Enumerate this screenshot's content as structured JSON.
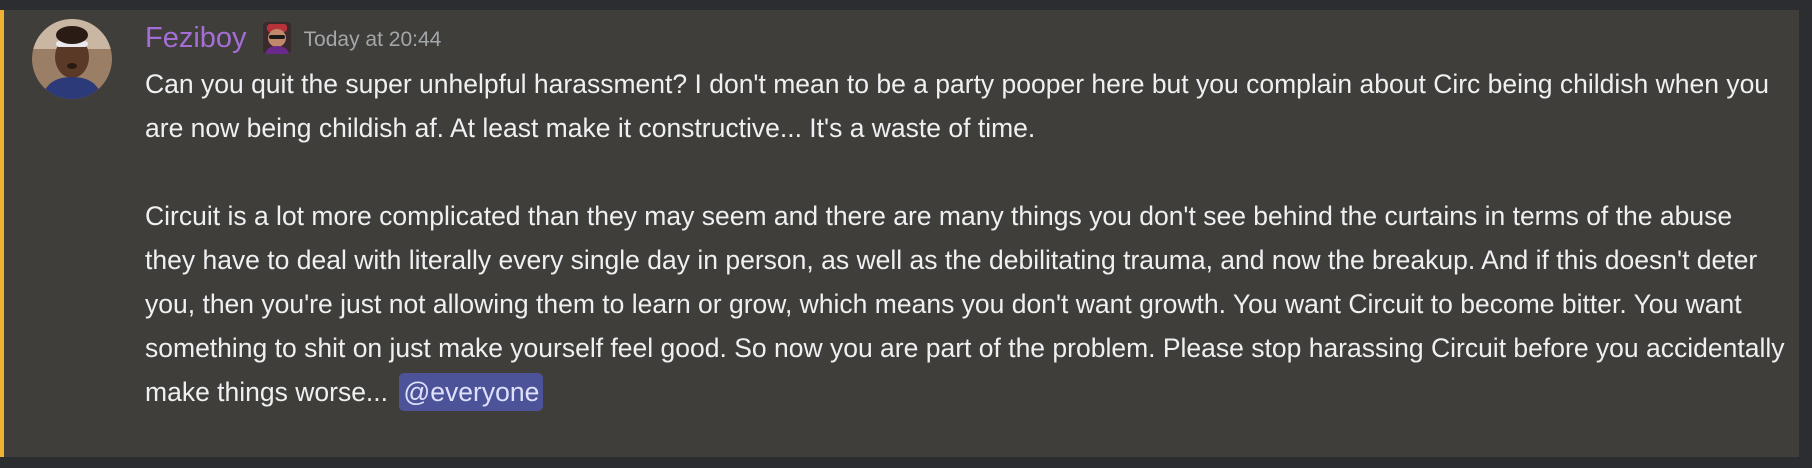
{
  "message": {
    "author": {
      "username": "Feziboy",
      "username_color": "#a46ed6",
      "avatar_icon": "user-avatar",
      "role_icon": "role-emoji-icon"
    },
    "timestamp": "Today at 20:44",
    "highlight_color": "#f0b232",
    "paragraphs": [
      "Can you quit the super unhelpful harassment? I don't mean to be a party pooper here but you complain about Circ being childish when you are now being childish af. At least make it constructive... It's a waste of time.",
      "Circuit is a lot more complicated than they may seem and there are many things you don't see behind the curtains in terms of the abuse they have to deal with literally every single day in person, as well as the debilitating trauma, and now the breakup. And if this doesn't deter you, then you're just not allowing them to learn or grow, which means you don't want growth. You want Circuit to become bitter. You want something to shit on just make yourself feel good. So now you are part of the problem. Please stop harassing Circuit before you accidentally make things worse..."
    ],
    "mention": "@everyone"
  }
}
